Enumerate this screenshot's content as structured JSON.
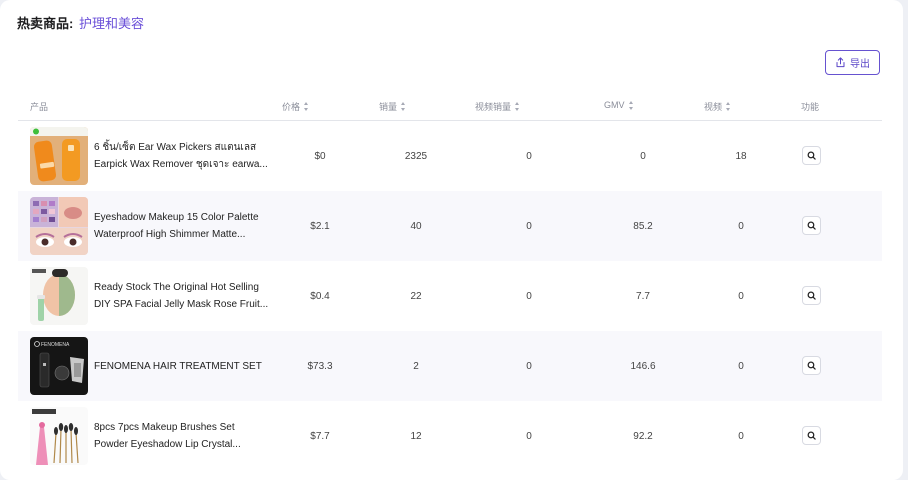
{
  "header": {
    "label": "热卖商品:",
    "category": "护理和美容"
  },
  "toolbar": {
    "export_label": "导出",
    "export_icon": "export-icon"
  },
  "columns": [
    {
      "label": "产品"
    },
    {
      "label": "价格"
    },
    {
      "label": "销量"
    },
    {
      "label": "视频销量"
    },
    {
      "label": "GMV"
    },
    {
      "label": "视频"
    },
    {
      "label": "功能"
    }
  ],
  "rows": [
    {
      "name": "6 ชิ้น/เซ็ต Ear Wax Pickers สแตนเลส Earpick Wax Remover ชุดเจาะ earwa...",
      "price": "$0",
      "sales": "2325",
      "video_sales": "0",
      "gmv": "0",
      "videos": "18",
      "action_icon": "search-icon"
    },
    {
      "name": "Eyeshadow Makeup 15 Color Palette Waterproof High Shimmer Matte...",
      "price": "$2.1",
      "sales": "40",
      "video_sales": "0",
      "gmv": "85.2",
      "videos": "0",
      "action_icon": "search-icon"
    },
    {
      "name": "Ready Stock The Original Hot Selling DIY SPA Facial Jelly Mask Rose Fruit...",
      "price": "$0.4",
      "sales": "22",
      "video_sales": "0",
      "gmv": "7.7",
      "videos": "0",
      "action_icon": "search-icon"
    },
    {
      "name": "FENOMENA HAIR TREATMENT SET",
      "price": "$73.3",
      "sales": "2",
      "video_sales": "0",
      "gmv": "146.6",
      "videos": "0",
      "action_icon": "search-icon",
      "thumb_text": "FENOMENA"
    },
    {
      "name": "8pcs 7pcs Makeup Brushes Set Powder Eyeshadow Lip Crystal...",
      "price": "$7.7",
      "sales": "12",
      "video_sales": "0",
      "gmv": "92.2",
      "videos": "0",
      "action_icon": "search-icon"
    }
  ],
  "colors": {
    "accent": "#6a4fd8",
    "row_alt_bg": "#f8f8fc"
  }
}
